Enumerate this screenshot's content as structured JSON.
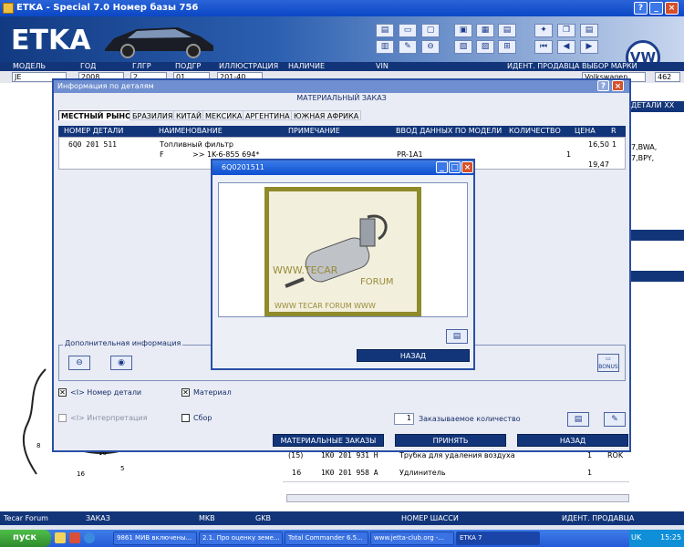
{
  "app": {
    "title": "ETKA - Special 7.0 Номер базы 756",
    "logo": "ETKA",
    "brand_logo": "VW"
  },
  "header": {
    "columns": [
      "МОДЕЛЬ",
      "ГОД",
      "ГЛГР",
      "ПОДГР",
      "ИЛЛЮСТРАЦИЯ",
      "НАЛИЧИЕ",
      "VIN",
      "ИДЕНТ. ПРОДАВЦА",
      "ВЫБОР МАРКИ"
    ],
    "values": {
      "model": "JE",
      "year": "2008",
      "glgr": "2",
      "podgr": "01",
      "illustration": "201-40",
      "brand_select": "Volkswagen",
      "dealer_code": "462"
    }
  },
  "bg_right": {
    "header": "ДЕТАЛИ ХХ",
    "text1": "7,BWA,",
    "text2": "7,BPY,"
  },
  "info_dialog": {
    "title": "Информация по деталям",
    "heading": "МАТЕРИАЛЬНЫЙ ЗАКАЗ",
    "tabs": [
      "МЕСТНЫЙ РЫНОК",
      "БРАЗИЛИЯ",
      "КИТАЙ",
      "МЕКСИКА",
      "АРГЕНТИНА",
      "ЮЖНАЯ АФРИКА"
    ],
    "table_headers": [
      "НОМЕР ДЕТАЛИ",
      "НАИМЕНОВАНИЕ",
      "ПРИМЕЧАНИЕ",
      "ВВОД ДАННЫХ ПО МОДЕЛИ",
      "КОЛИЧЕСТВО",
      "ЦЕНА",
      "R"
    ],
    "row": {
      "part_no": "6Q0 201 511",
      "name": "Топливный фильтр",
      "flag": "F",
      "ref": ">> 1K-6-855 694*",
      "model_data": "PR-1A1",
      "qty": "1",
      "price": "16,50",
      "price2": "19,47",
      "r": "1"
    },
    "extra_label": "Дополнительная информация",
    "checkbox_part": "<I> Номер детали",
    "checkbox_material": "Материал",
    "checkbox_interp": "<I> Интерпретация",
    "checkbox_sbor": "Сбор",
    "order_qty_value": "1",
    "order_qty_label": "Заказываемое количество",
    "btn_orders": "МАТЕРИАЛЬНЫЕ ЗАКАЗЫ",
    "btn_accept": "ПРИНЯТЬ",
    "btn_back": "НАЗАД",
    "bonus": "BONUS"
  },
  "image_dialog": {
    "title": "6Q0201511",
    "watermark1": "WWW.TECAR",
    "watermark2": "FORUM",
    "watermark3": "WWW TECAR FORUM WWW",
    "back_label": "НАЗАД"
  },
  "bg_rows": [
    {
      "num": "(15)",
      "part": "1K0 201 931 H",
      "name": "Трубка для удаления воздуха",
      "qty": "1",
      "extra": "ROK"
    },
    {
      "num": "16",
      "part": "1K0 201 958 A",
      "name": "Удлинитель",
      "qty": "1",
      "extra": ""
    }
  ],
  "diagram_labels": {
    "a": "8",
    "b": "10",
    "c": "16",
    "d": "5"
  },
  "statusbar": {
    "left": "Tecar Forum",
    "order": "ЗАКАЗ",
    "mkv": "MKB",
    "gkb": "GKB",
    "chassis": "НОМЕР ШАССИ",
    "dealer": "ИДЕНТ. ПРОДАВЦА"
  },
  "taskbar": {
    "start": "пуск",
    "items": [
      "9861 МИВ включены...",
      "2.1. Про оценку земе...",
      "Total Commander 6.5...",
      "www.jetta-club.org -...",
      "ETKA 7"
    ],
    "lang": "UK",
    "time": "15:25"
  }
}
